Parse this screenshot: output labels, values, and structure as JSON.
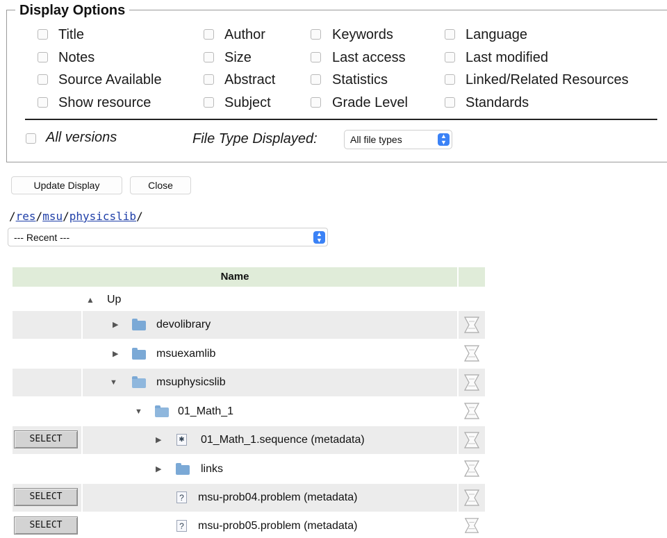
{
  "display_options": {
    "legend": "Display Options",
    "columns": [
      [
        "Title",
        "Notes",
        "Source Available",
        "Show resource"
      ],
      [
        "Author",
        "Size",
        "Abstract",
        "Subject"
      ],
      [
        "Keywords",
        "Last access",
        "Statistics",
        "Grade Level"
      ],
      [
        "Language",
        "Last modified",
        "Linked/Related Resources",
        "Standards"
      ]
    ],
    "all_versions_label": "All versions",
    "file_type_label": "File Type Displayed:",
    "file_type_value": "All file types"
  },
  "buttons": {
    "update": "Update Display",
    "close": "Close"
  },
  "path": {
    "segments": [
      "res",
      "msu",
      "physicslib"
    ],
    "sep": "/"
  },
  "recent_select": "--- Recent ---",
  "table": {
    "header": "Name",
    "up_label": "Up",
    "select_label": "SELECT",
    "rows": [
      {
        "name": "devolibrary"
      },
      {
        "name": "msuexamlib"
      },
      {
        "name": "msuphysicslib"
      },
      {
        "name": "01_Math_1"
      },
      {
        "name": "01_Math_1.sequence (metadata)"
      },
      {
        "name": "links"
      },
      {
        "name": "msu-prob04.problem (metadata)"
      },
      {
        "name": "msu-prob05.problem (metadata)"
      }
    ]
  },
  "icons": {
    "checkbox": "checkbox-icon",
    "folder": "folder-icon",
    "problem": "question-file-icon",
    "sequence": "sequence-file-icon",
    "metadata": "metadata-icon",
    "up": "up-arrow-icon"
  },
  "colors": {
    "header_bg": "#e0ecd9",
    "link": "#1f3fa8",
    "select_arrow": "#3b82f6",
    "folder": "#7ba9d6"
  }
}
